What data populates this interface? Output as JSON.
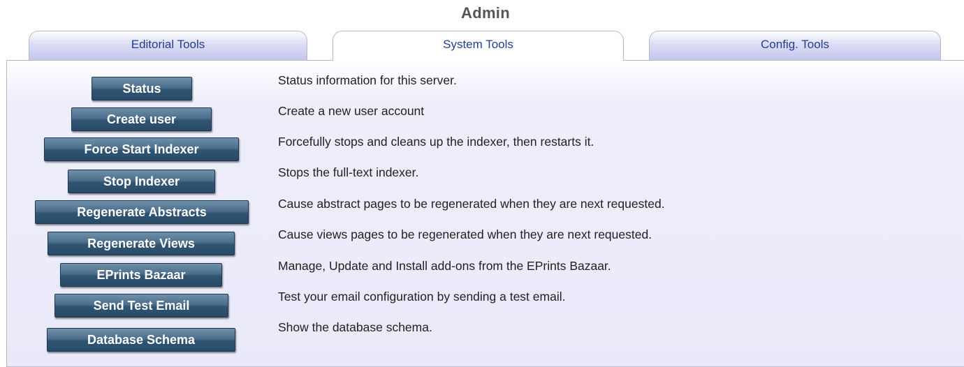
{
  "page": {
    "title": "Admin"
  },
  "tabs": [
    {
      "label": "Editorial Tools",
      "active": false
    },
    {
      "label": "System Tools",
      "active": true
    },
    {
      "label": "Config. Tools",
      "active": false
    }
  ],
  "tools": [
    {
      "button": "Status",
      "description": "Status information for this server."
    },
    {
      "button": "Create user",
      "description": "Create a new user account"
    },
    {
      "button": "Force Start Indexer",
      "description": "Forcefully stops and cleans up the indexer, then restarts it."
    },
    {
      "button": "Stop Indexer",
      "description": "Stops the full-text indexer."
    },
    {
      "button": "Regenerate Abstracts",
      "description": "Cause abstract pages to be regenerated when they are next requested."
    },
    {
      "button": "Regenerate Views",
      "description": "Cause views pages to be regenerated when they are next requested."
    },
    {
      "button": "EPrints Bazaar",
      "description": "Manage, Update and Install add-ons from the EPrints Bazaar."
    },
    {
      "button": "Send Test Email",
      "description": "Test your email configuration by sending a test email."
    },
    {
      "button": "Database Schema",
      "description": "Show the database schema."
    }
  ],
  "colors": {
    "tab_text": "#1f3f8f",
    "button_bg": "#3f6280",
    "panel_bg": "#eeeefb"
  }
}
